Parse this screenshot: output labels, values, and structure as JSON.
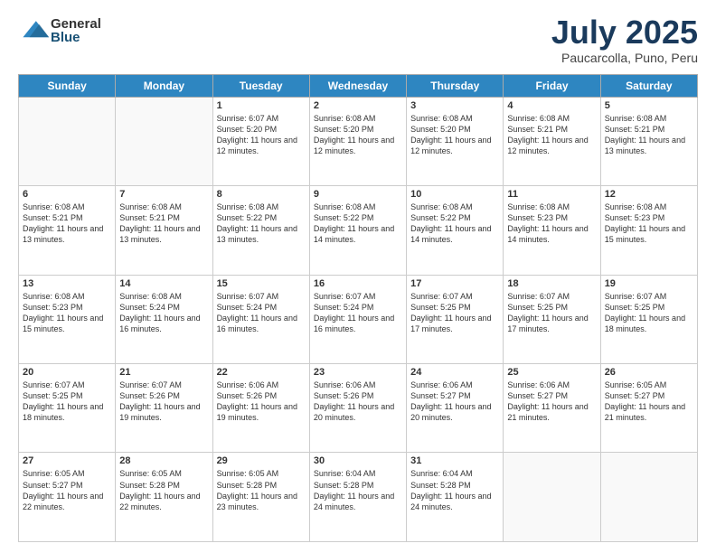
{
  "header": {
    "logo_line1": "General",
    "logo_line2": "Blue",
    "title": "July 2025",
    "location": "Paucarcolla, Puno, Peru"
  },
  "weekdays": [
    "Sunday",
    "Monday",
    "Tuesday",
    "Wednesday",
    "Thursday",
    "Friday",
    "Saturday"
  ],
  "weeks": [
    [
      {
        "day": "",
        "info": ""
      },
      {
        "day": "",
        "info": ""
      },
      {
        "day": "1",
        "info": "Sunrise: 6:07 AM\nSunset: 5:20 PM\nDaylight: 11 hours and 12 minutes."
      },
      {
        "day": "2",
        "info": "Sunrise: 6:08 AM\nSunset: 5:20 PM\nDaylight: 11 hours and 12 minutes."
      },
      {
        "day": "3",
        "info": "Sunrise: 6:08 AM\nSunset: 5:20 PM\nDaylight: 11 hours and 12 minutes."
      },
      {
        "day": "4",
        "info": "Sunrise: 6:08 AM\nSunset: 5:21 PM\nDaylight: 11 hours and 12 minutes."
      },
      {
        "day": "5",
        "info": "Sunrise: 6:08 AM\nSunset: 5:21 PM\nDaylight: 11 hours and 13 minutes."
      }
    ],
    [
      {
        "day": "6",
        "info": "Sunrise: 6:08 AM\nSunset: 5:21 PM\nDaylight: 11 hours and 13 minutes."
      },
      {
        "day": "7",
        "info": "Sunrise: 6:08 AM\nSunset: 5:21 PM\nDaylight: 11 hours and 13 minutes."
      },
      {
        "day": "8",
        "info": "Sunrise: 6:08 AM\nSunset: 5:22 PM\nDaylight: 11 hours and 13 minutes."
      },
      {
        "day": "9",
        "info": "Sunrise: 6:08 AM\nSunset: 5:22 PM\nDaylight: 11 hours and 14 minutes."
      },
      {
        "day": "10",
        "info": "Sunrise: 6:08 AM\nSunset: 5:22 PM\nDaylight: 11 hours and 14 minutes."
      },
      {
        "day": "11",
        "info": "Sunrise: 6:08 AM\nSunset: 5:23 PM\nDaylight: 11 hours and 14 minutes."
      },
      {
        "day": "12",
        "info": "Sunrise: 6:08 AM\nSunset: 5:23 PM\nDaylight: 11 hours and 15 minutes."
      }
    ],
    [
      {
        "day": "13",
        "info": "Sunrise: 6:08 AM\nSunset: 5:23 PM\nDaylight: 11 hours and 15 minutes."
      },
      {
        "day": "14",
        "info": "Sunrise: 6:08 AM\nSunset: 5:24 PM\nDaylight: 11 hours and 16 minutes."
      },
      {
        "day": "15",
        "info": "Sunrise: 6:07 AM\nSunset: 5:24 PM\nDaylight: 11 hours and 16 minutes."
      },
      {
        "day": "16",
        "info": "Sunrise: 6:07 AM\nSunset: 5:24 PM\nDaylight: 11 hours and 16 minutes."
      },
      {
        "day": "17",
        "info": "Sunrise: 6:07 AM\nSunset: 5:25 PM\nDaylight: 11 hours and 17 minutes."
      },
      {
        "day": "18",
        "info": "Sunrise: 6:07 AM\nSunset: 5:25 PM\nDaylight: 11 hours and 17 minutes."
      },
      {
        "day": "19",
        "info": "Sunrise: 6:07 AM\nSunset: 5:25 PM\nDaylight: 11 hours and 18 minutes."
      }
    ],
    [
      {
        "day": "20",
        "info": "Sunrise: 6:07 AM\nSunset: 5:25 PM\nDaylight: 11 hours and 18 minutes."
      },
      {
        "day": "21",
        "info": "Sunrise: 6:07 AM\nSunset: 5:26 PM\nDaylight: 11 hours and 19 minutes."
      },
      {
        "day": "22",
        "info": "Sunrise: 6:06 AM\nSunset: 5:26 PM\nDaylight: 11 hours and 19 minutes."
      },
      {
        "day": "23",
        "info": "Sunrise: 6:06 AM\nSunset: 5:26 PM\nDaylight: 11 hours and 20 minutes."
      },
      {
        "day": "24",
        "info": "Sunrise: 6:06 AM\nSunset: 5:27 PM\nDaylight: 11 hours and 20 minutes."
      },
      {
        "day": "25",
        "info": "Sunrise: 6:06 AM\nSunset: 5:27 PM\nDaylight: 11 hours and 21 minutes."
      },
      {
        "day": "26",
        "info": "Sunrise: 6:05 AM\nSunset: 5:27 PM\nDaylight: 11 hours and 21 minutes."
      }
    ],
    [
      {
        "day": "27",
        "info": "Sunrise: 6:05 AM\nSunset: 5:27 PM\nDaylight: 11 hours and 22 minutes."
      },
      {
        "day": "28",
        "info": "Sunrise: 6:05 AM\nSunset: 5:28 PM\nDaylight: 11 hours and 22 minutes."
      },
      {
        "day": "29",
        "info": "Sunrise: 6:05 AM\nSunset: 5:28 PM\nDaylight: 11 hours and 23 minutes."
      },
      {
        "day": "30",
        "info": "Sunrise: 6:04 AM\nSunset: 5:28 PM\nDaylight: 11 hours and 24 minutes."
      },
      {
        "day": "31",
        "info": "Sunrise: 6:04 AM\nSunset: 5:28 PM\nDaylight: 11 hours and 24 minutes."
      },
      {
        "day": "",
        "info": ""
      },
      {
        "day": "",
        "info": ""
      }
    ]
  ]
}
